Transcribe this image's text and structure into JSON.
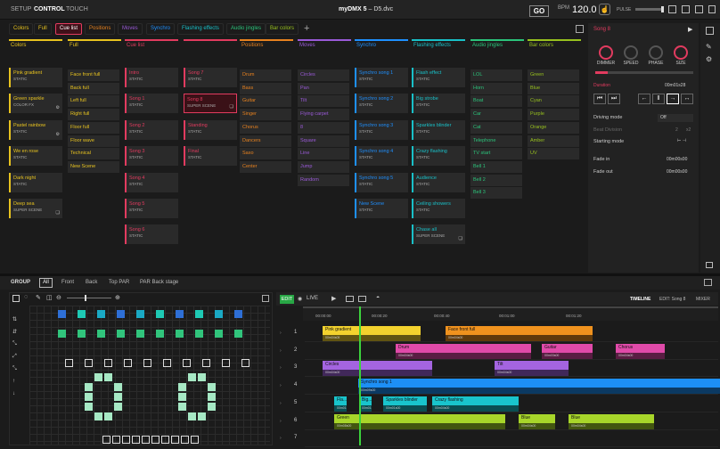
{
  "topbar": {
    "tabs": [
      "SETUP",
      "CONTROL",
      "TOUCH"
    ],
    "active": 1,
    "app_name": "myDMX 5",
    "file": "D5.dvc",
    "go": "GO",
    "bpm_label": "BPM",
    "bpm_value": "120.0",
    "pulse_label": "PULSE"
  },
  "categories": [
    {
      "label": "Colors",
      "color": "#e8c31f"
    },
    {
      "label": "Full",
      "color": "#e8c31f"
    },
    {
      "label": "Cue list",
      "color": "#e23b5f",
      "active": true
    },
    {
      "label": "Positions",
      "color": "#e8821f"
    },
    {
      "label": "Moves",
      "color": "#9a5ad8"
    },
    {
      "label": "Synchro",
      "color": "#1e90ff"
    },
    {
      "label": "Flashing effects",
      "color": "#19c0c8"
    },
    {
      "label": "Audio jingles",
      "color": "#2bc47b"
    },
    {
      "label": "Bar colors",
      "color": "#98c11e"
    }
  ],
  "columns": [
    {
      "title": "Colors",
      "color": "#e8c31f",
      "cards": [
        {
          "name": "Pink gradient",
          "type": "STATIC"
        },
        {
          "name": "Green sparkle",
          "type": "COLOR FX",
          "icon": "gear"
        },
        {
          "name": "Pastel rainbow",
          "type": "STATIC",
          "icon": "gear"
        },
        {
          "name": "We en rose",
          "type": "STATIC"
        },
        {
          "name": "Dark night",
          "type": "STATIC"
        },
        {
          "name": "Deep sea",
          "type": "SUPER SCENE",
          "icon": "layers"
        }
      ]
    },
    {
      "title": "Full",
      "color": "#e8c31f",
      "compact": true,
      "cards": [
        {
          "name": "Face front full"
        },
        {
          "name": "Back full"
        },
        {
          "name": "Left full"
        },
        {
          "name": "Right full"
        },
        {
          "name": "Floor full"
        },
        {
          "name": "Floor wave"
        },
        {
          "name": "Technical"
        },
        {
          "name": "New Scene"
        }
      ]
    },
    {
      "title": "Cue list",
      "color": "#e23b5f",
      "cards": [
        {
          "name": "Intro",
          "type": "STATIC"
        },
        {
          "name": "Song 1",
          "type": "STATIC"
        },
        {
          "name": "Song 2",
          "type": "STATIC"
        },
        {
          "name": "Song 3",
          "type": "STATIC"
        },
        {
          "name": "Song 4",
          "type": "STATIC"
        },
        {
          "name": "Song 5",
          "type": "STATIC"
        },
        {
          "name": "Song 6",
          "type": "STATIC"
        }
      ]
    },
    {
      "title": "",
      "color": "#e23b5f",
      "cards": [
        {
          "name": "Song 7",
          "type": "STATIC"
        },
        {
          "name": "Song 8",
          "type": "SUPER SCENE",
          "selected": true,
          "icon": "layers"
        },
        {
          "name": "Standing",
          "type": "STATIC"
        },
        {
          "name": "Final",
          "type": "STATIC"
        }
      ]
    },
    {
      "title": "Positions",
      "color": "#e8821f",
      "compact": true,
      "cards": [
        {
          "name": "Drum"
        },
        {
          "name": "Bass"
        },
        {
          "name": "Guitar"
        },
        {
          "name": "Singer"
        },
        {
          "name": "Chorus"
        },
        {
          "name": "Dancers"
        },
        {
          "name": "Saxo"
        },
        {
          "name": "Center"
        }
      ]
    },
    {
      "title": "Moves",
      "color": "#9a5ad8",
      "compact": true,
      "cards": [
        {
          "name": "Circles"
        },
        {
          "name": "Pan"
        },
        {
          "name": "Tilt"
        },
        {
          "name": "Flying carpet"
        },
        {
          "name": "8"
        },
        {
          "name": "Square"
        },
        {
          "name": "Line"
        },
        {
          "name": "Jump"
        },
        {
          "name": "Random"
        }
      ]
    },
    {
      "title": "Synchro",
      "color": "#1e90ff",
      "cards": [
        {
          "name": "Synchro song 1",
          "type": "STATIC"
        },
        {
          "name": "Synchro song 2",
          "type": "STATIC"
        },
        {
          "name": "Synchro song 3",
          "type": "STATIC"
        },
        {
          "name": "Synchro song 4",
          "type": "STATIC"
        },
        {
          "name": "Synchro song 5",
          "type": "STATIC"
        },
        {
          "name": "New Scene",
          "type": "STATIC"
        }
      ]
    },
    {
      "title": "Flashing effects",
      "color": "#19c0c8",
      "cards": [
        {
          "name": "Flash effect",
          "type": "STATIC"
        },
        {
          "name": "Big strobe",
          "type": "STATIC"
        },
        {
          "name": "Sparkles blinder",
          "type": "STATIC"
        },
        {
          "name": "Crazy flashing",
          "type": "STATIC"
        },
        {
          "name": "Audience",
          "type": "STATIC"
        },
        {
          "name": "Ceiling showers",
          "type": "STATIC"
        },
        {
          "name": "Chase all",
          "type": "SUPER SCENE",
          "icon": "layers"
        }
      ]
    },
    {
      "title": "Audio jingles",
      "color": "#2bc47b",
      "compact": true,
      "cards": [
        {
          "name": "LOL"
        },
        {
          "name": "Horn"
        },
        {
          "name": "Boat"
        },
        {
          "name": "Car"
        },
        {
          "name": "Cat"
        },
        {
          "name": "Telephone"
        },
        {
          "name": "TV start"
        },
        {
          "name": "Bell 1"
        },
        {
          "name": "Bell 2"
        },
        {
          "name": "Bell 3"
        }
      ]
    },
    {
      "title": "Bar colors",
      "color": "#98c11e",
      "compact": true,
      "cards": [
        {
          "name": "Green"
        },
        {
          "name": "Blue"
        },
        {
          "name": "Cyan"
        },
        {
          "name": "Purple"
        },
        {
          "name": "Orange"
        },
        {
          "name": "Amber"
        },
        {
          "name": "UV"
        }
      ]
    }
  ],
  "right": {
    "title": "Song 8",
    "knobs": [
      "DIMMER",
      "SPEED",
      "PHASE",
      "SIZE"
    ],
    "duration": "Duration",
    "duration_value": "00m01s28",
    "driving_mode": "Driving mode",
    "driving_value": "Off",
    "beat_division": "Beat Division",
    "beat_value": "2",
    "beat_value2": "x2",
    "starting_mode": "Starting mode",
    "fade_in": "Fade in",
    "fade_in_value": "00m00s00",
    "fade_out": "Fade out",
    "fade_out_value": "00m00s00"
  },
  "group": {
    "title": "GROUP",
    "tabs": [
      "All",
      "Front",
      "Back",
      "Top PAR",
      "PAR Back stage"
    ]
  },
  "timeline": {
    "edit": "EDIT",
    "live": "LIVE",
    "tabs": [
      "TIMELINE",
      "EDIT: Song 8",
      "MIXER"
    ],
    "ticks": [
      "00:00:00",
      "00:00:20",
      "00:00:40",
      "00:01:00",
      "00:01:20"
    ],
    "tracks": [
      "1",
      "2",
      "3",
      "4",
      "5",
      "6",
      "7"
    ],
    "clips": [
      {
        "label": "Pink gradient",
        "sub": "00m04s05",
        "color": "#f3d22e",
        "track": 0,
        "start": 20,
        "width": 110
      },
      {
        "label": "Face front full",
        "sub": "00m04s00",
        "color": "#f0921e",
        "track": 0,
        "start": 158,
        "width": 165
      },
      {
        "label": "Drum",
        "sub": "00m04s00",
        "color": "#e04aa9",
        "track": 1,
        "start": 102,
        "width": 152
      },
      {
        "label": "Guitar",
        "sub": "00m03s00",
        "color": "#e04aa9",
        "track": 1,
        "start": 266,
        "width": 57
      },
      {
        "label": "Chorus",
        "sub": "00m04s00",
        "color": "#e04aa9",
        "track": 1,
        "start": 349,
        "width": 55
      },
      {
        "label": "Circles",
        "sub": "00m04s00",
        "color": "#a464e0",
        "track": 2,
        "start": 20,
        "width": 123
      },
      {
        "label": "Tilt",
        "sub": "00m04s00",
        "color": "#a464e0",
        "track": 2,
        "start": 213,
        "width": 83
      },
      {
        "label": "Synchro song 1",
        "sub": "00m09s00",
        "color": "#1d8ff5",
        "track": 3,
        "start": 60,
        "width": 430
      },
      {
        "label": "Fla...",
        "sub": "00m01s00",
        "color": "#19c4cc",
        "track": 4,
        "start": 33,
        "width": 14
      },
      {
        "label": "Big...",
        "sub": "00m01s00",
        "color": "#19c4cc",
        "track": 4,
        "start": 61,
        "width": 14
      },
      {
        "label": "Sparkles blinder",
        "sub": "00m01s00",
        "color": "#19c4cc",
        "track": 4,
        "start": 88,
        "width": 49
      },
      {
        "label": "Crazy flashing",
        "sub": "00m04s00",
        "color": "#19c4cc",
        "track": 4,
        "start": 143,
        "width": 97
      },
      {
        "label": "Green",
        "sub": "00m08s00",
        "color": "#a8d62a",
        "track": 5,
        "start": 33,
        "width": 192
      },
      {
        "label": "Blue",
        "sub": "00m04s00",
        "color": "#a8d62a",
        "track": 5,
        "start": 240,
        "width": 41
      },
      {
        "label": "Blue",
        "sub": "00m04s00",
        "color": "#a8d62a",
        "track": 5,
        "start": 296,
        "width": 96
      }
    ]
  }
}
